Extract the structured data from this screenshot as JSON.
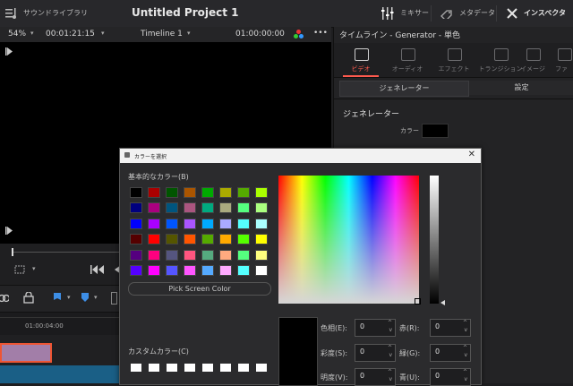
{
  "topbar": {
    "sound_library": "サウンドライブラリ",
    "project_title": "Untitled Project 1",
    "mixer": "ミキサー",
    "metadata": "メタデータ",
    "inspector": "インスペクタ"
  },
  "viewer": {
    "zoom": "54%",
    "timecode": "00:01:21:15",
    "timeline_name": "Timeline 1",
    "timeline_tc": "01:00:00:00",
    "more": "•••"
  },
  "timeline": {
    "ruler_tc": "01:00:04:00"
  },
  "inspector": {
    "title": "タイムライン - Generator - 単色",
    "tabs": [
      {
        "label": "ビデオ",
        "active": true
      },
      {
        "label": "オーディオ",
        "active": false
      },
      {
        "label": "エフェクト",
        "active": false
      },
      {
        "label": "トランジション",
        "active": false
      },
      {
        "label": "イメージ",
        "active": false
      },
      {
        "label": "ファ",
        "active": false
      }
    ],
    "subtabs": [
      "ジェネレーター",
      "設定"
    ],
    "section": "ジェネレーター",
    "color_label": "カラー",
    "accent_color": "#ff5a4e"
  },
  "color_dialog": {
    "title": "カラーを選択",
    "basic_colors_label": "基本的なカラー(B)",
    "basic_colors": [
      [
        "#000000",
        "#aa0000",
        "#005500",
        "#aa5500",
        "#00aa00",
        "#aaaa00",
        "#55aa00",
        "#aaff00"
      ],
      [
        "#00007f",
        "#aa007f",
        "#00557f",
        "#aa557f",
        "#00aa7f",
        "#aaaa7f",
        "#55ff7f",
        "#aaff7f"
      ],
      [
        "#0000ff",
        "#aa00ff",
        "#0055ff",
        "#aa55ff",
        "#00aaff",
        "#aaaaff",
        "#55ffff",
        "#aaffff"
      ],
      [
        "#550000",
        "#ff0000",
        "#555500",
        "#ff5500",
        "#55aa00",
        "#ffaa00",
        "#55ff00",
        "#ffff00"
      ],
      [
        "#55007f",
        "#ff007f",
        "#55557f",
        "#ff557f",
        "#55aa7f",
        "#ffaa7f",
        "#55ff7f",
        "#ffff7f"
      ],
      [
        "#5500ff",
        "#ff00ff",
        "#5555ff",
        "#ff55ff",
        "#55aaff",
        "#ffaaff",
        "#55ffff",
        "#ffffff"
      ]
    ],
    "pick_screen_color": "Pick Screen Color",
    "custom_colors_label": "カスタムカラー(C)",
    "hue_label": "色相(E):",
    "sat_label": "彩度(S):",
    "val_label": "明度(V):",
    "red_label": "赤(R):",
    "green_label": "緑(G):",
    "blue_label": "青(U):",
    "hue": "0",
    "sat": "0",
    "val": "0",
    "red": "0",
    "green": "0",
    "blue": "0"
  }
}
